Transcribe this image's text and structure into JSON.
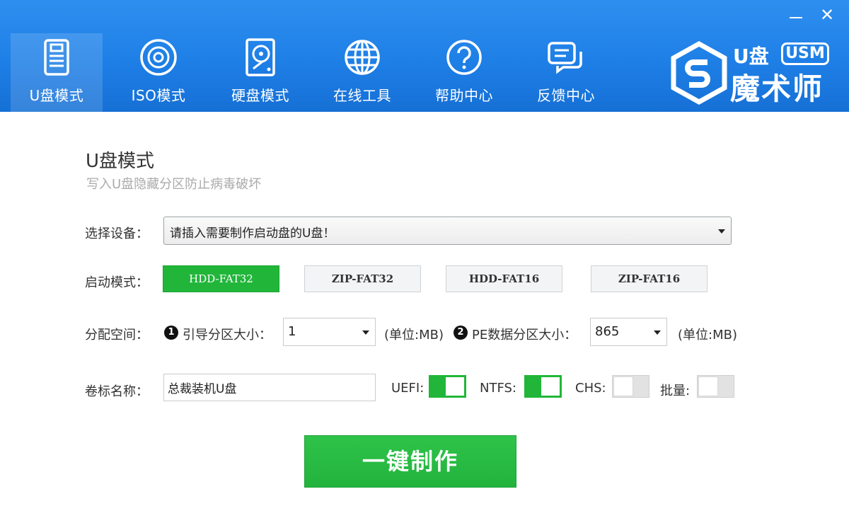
{
  "window": {
    "minimize_glyph": "",
    "close_glyph": "✕"
  },
  "nav": {
    "items": [
      {
        "label": "U盘模式",
        "icon": "usb-drive-icon",
        "active": true
      },
      {
        "label": "ISO模式",
        "icon": "disc-icon",
        "active": false
      },
      {
        "label": "硬盘模式",
        "icon": "hard-disk-icon",
        "active": false
      },
      {
        "label": "在线工具",
        "icon": "globe-icon",
        "active": false
      },
      {
        "label": "帮助中心",
        "icon": "help-icon",
        "active": false
      },
      {
        "label": "反馈中心",
        "icon": "feedback-icon",
        "active": false
      }
    ]
  },
  "logo": {
    "small": "U盘",
    "badge": "USM",
    "big": "魔术师"
  },
  "main": {
    "title": "U盘模式",
    "subtitle": "写入U盘隐藏分区防止病毒破坏",
    "device": {
      "label": "选择设备：",
      "value": "请插入需要制作启动盘的U盘！"
    },
    "boot_mode": {
      "label": "启动模式：",
      "options": [
        "HDD-FAT32",
        "ZIP-FAT32",
        "HDD-FAT16",
        "ZIP-FAT16"
      ],
      "selected": "HDD-FAT32"
    },
    "partition": {
      "label": "分配空间：",
      "boot_badge": "1",
      "boot_label": "引导分区大小：",
      "boot_value": "1",
      "boot_unit": "(单位:MB)",
      "pe_badge": "2",
      "pe_label": "PE数据分区大小：",
      "pe_value": "865",
      "pe_unit": "(单位:MB)"
    },
    "volume": {
      "label": "卷标名称：",
      "value": "总裁装机U盘"
    },
    "switches": [
      {
        "label": "UEFI:",
        "on": true
      },
      {
        "label": "NTFS:",
        "on": true
      },
      {
        "label": "CHS:",
        "on": false
      },
      {
        "label": "批量:",
        "on": false
      }
    ],
    "make_button": "一键制作"
  },
  "colors": {
    "header": "#1e7fe6",
    "accent_green": "#21b63a"
  }
}
